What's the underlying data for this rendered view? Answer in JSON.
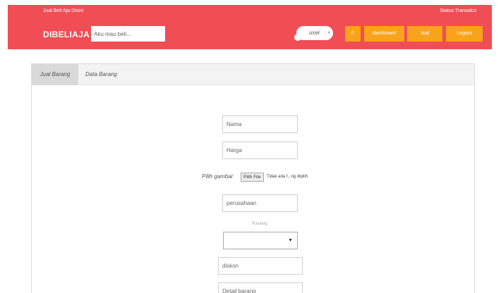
{
  "header": {
    "tagline": "Jual Beli Aja Disini",
    "status_link": "Status Transaksi",
    "brand": "DIBELIAJA",
    "search_placeholder": "Aku mau beli...",
    "user": {
      "name": "user",
      "close": "×"
    },
    "buttons": {
      "cart": "0",
      "dashboard": "dashboard",
      "jual": "Jual",
      "logout": "Logout"
    }
  },
  "tabs": [
    {
      "label": "Jual Barang",
      "active": true
    },
    {
      "label": "Data Barang",
      "active": false
    }
  ],
  "form": {
    "nama_placeholder": "Nama",
    "harga_placeholder": "Harga",
    "gambar_label": "Pilih gambar",
    "file_button": "Pilih File",
    "file_status": "Tidak ada f...ng dipilih",
    "perusahaan_placeholder": "perusahaan",
    "katalog_label": "*Katalog",
    "katalog_selected": "",
    "diskon_placeholder": "diskon",
    "detail_placeholder": "Detail barang"
  },
  "colors": {
    "header_bg": "#f04d55",
    "button_bg": "#f9a21b",
    "active_tab_bg": "#d9d9d9"
  },
  "icons": {
    "dropdown": "caret-down-icon",
    "user_remove": "close-icon"
  }
}
